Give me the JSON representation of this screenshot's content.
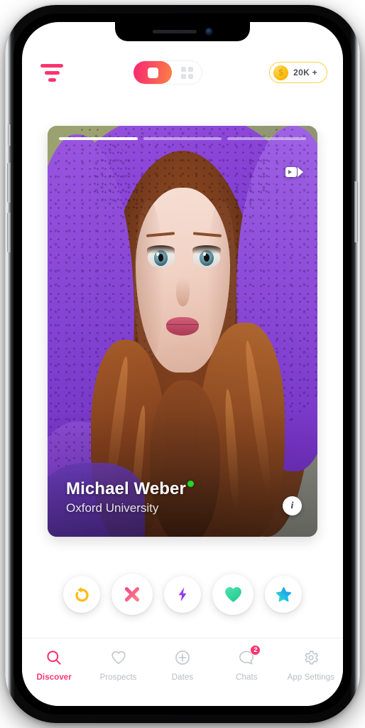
{
  "header": {
    "filter_icon": "filter-icon",
    "view_toggle": {
      "card_view_icon": "card-view-icon",
      "grid_view_icon": "grid-view-icon",
      "selected": "card"
    },
    "coin_badge": {
      "icon": "coin-icon",
      "symbol": "$",
      "amount": "20K +"
    }
  },
  "card": {
    "story_count": 3,
    "active_story_index": 0,
    "video_icon": "video-camera-icon",
    "name": "Michael Weber",
    "subtitle": "Oxford University",
    "online": true,
    "online_color": "#22d62a",
    "info_label": "i",
    "photo_alt": "Portrait of a woman with long red hair wearing a purple lace hood"
  },
  "actions": [
    {
      "name": "rewind",
      "icon": "rewind-icon",
      "color": "#ffbb14",
      "glyph": "rewind"
    },
    {
      "name": "dislike",
      "icon": "close-x-icon",
      "color": "#f75c7f",
      "glyph": "x"
    },
    {
      "name": "boost",
      "icon": "lightning-bolt-icon",
      "color": "#9b46ef",
      "glyph": "bolt"
    },
    {
      "name": "like",
      "icon": "heart-icon",
      "color": "#33d9a6",
      "glyph": "heart"
    },
    {
      "name": "superlike",
      "icon": "star-icon",
      "color": "#1fa5f0",
      "glyph": "star"
    }
  ],
  "bottom_nav": {
    "active": "Discover",
    "items": [
      {
        "label": "Discover",
        "icon": "search-icon",
        "badge": null
      },
      {
        "label": "Prospects",
        "icon": "heart-outline-icon",
        "badge": null
      },
      {
        "label": "Dates",
        "icon": "plus-circle-icon",
        "badge": null
      },
      {
        "label": "Chats",
        "icon": "chat-bubble-icon",
        "badge": "2"
      },
      {
        "label": "App Settings",
        "icon": "gear-icon",
        "badge": null
      }
    ]
  },
  "theme": {
    "accent": "#f9356e",
    "toggle_gradient_start": "#f6276f",
    "toggle_gradient_end": "#fc8243",
    "coin_gold": "#fdbb0d",
    "muted_text": "#b8bcc2"
  }
}
